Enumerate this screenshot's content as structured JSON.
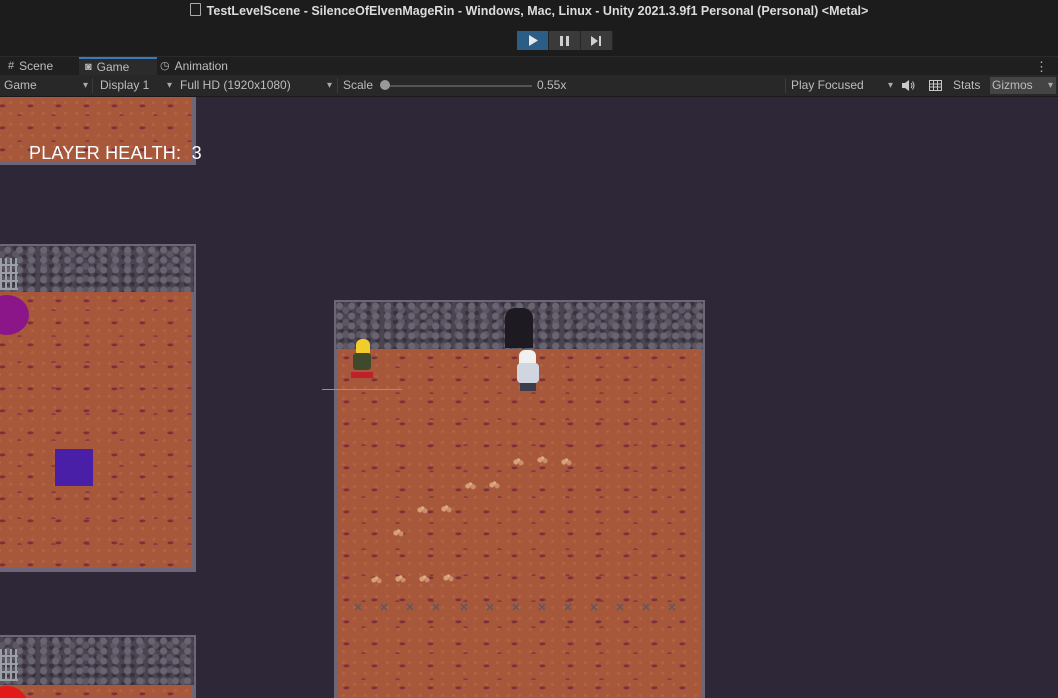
{
  "window": {
    "title": "TestLevelScene - SilenceOfElvenMageRin - Windows, Mac, Linux - Unity 2021.3.9f1 Personal (Personal) <Metal>",
    "play_state": "playing"
  },
  "tabs": [
    {
      "label": "Scene",
      "icon": "hash-icon",
      "active": false
    },
    {
      "label": "Game",
      "icon": "gamepad-icon",
      "active": true
    },
    {
      "label": "Animation",
      "icon": "clock-icon",
      "active": false
    }
  ],
  "toolbar": {
    "view_mode": "Game",
    "display": "Display 1",
    "resolution": "Full HD (1920x1080)",
    "scale_label": "Scale",
    "scale_value": "0.55x",
    "play_mode": "Play Focused",
    "stats": "Stats",
    "gizmos": "Gizmos"
  },
  "game": {
    "hud_label": "PLAYER HEALTH:",
    "hud_value": "3"
  },
  "colors": {
    "accent_play": "#2c5d87",
    "floor": "#a8583a",
    "wall": "#4a4450",
    "background": "#2e2738",
    "purple_circle": "#8a168a",
    "red_circle": "#e31818",
    "blue_square": "#4a1fa8"
  }
}
